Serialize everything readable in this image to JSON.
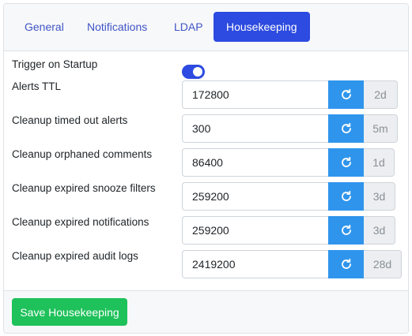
{
  "tabs": [
    {
      "label": "General"
    },
    {
      "label": "Notifications"
    },
    {
      "label": "LDAP"
    },
    {
      "label": "Housekeeping"
    }
  ],
  "active_tab": "Housekeeping",
  "trigger_on_startup": {
    "label": "Trigger on Startup",
    "enabled": true
  },
  "settings": [
    {
      "label": "Alerts TTL",
      "value": "172800",
      "unit": "2d"
    },
    {
      "label": "Cleanup timed out alerts",
      "value": "300",
      "unit": "5m"
    },
    {
      "label": "Cleanup orphaned comments",
      "value": "86400",
      "unit": "1d"
    },
    {
      "label": "Cleanup expired snooze filters",
      "value": "259200",
      "unit": "3d"
    },
    {
      "label": "Cleanup expired notifications",
      "value": "259200",
      "unit": "3d"
    },
    {
      "label": "Cleanup expired audit logs",
      "value": "2419200",
      "unit": "28d"
    }
  ],
  "save_label": "Save Housekeeping",
  "icons": {
    "reset": "refresh-icon"
  },
  "colors": {
    "accent": "#2d4be0",
    "reset": "#2f95ec",
    "save": "#1ec15a"
  }
}
